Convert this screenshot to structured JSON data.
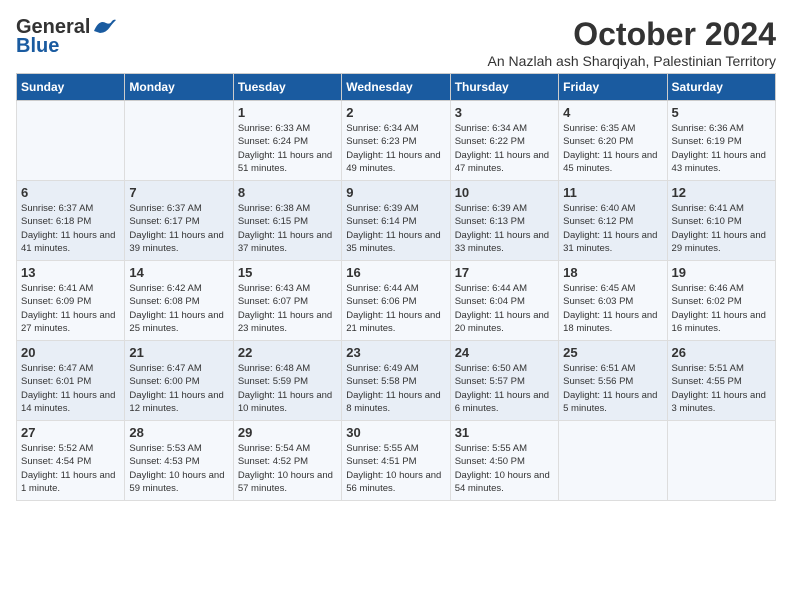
{
  "header": {
    "logo_general": "General",
    "logo_blue": "Blue",
    "month": "October 2024",
    "location": "An Nazlah ash Sharqiyah, Palestinian Territory"
  },
  "days_of_week": [
    "Sunday",
    "Monday",
    "Tuesday",
    "Wednesday",
    "Thursday",
    "Friday",
    "Saturday"
  ],
  "weeks": [
    [
      {
        "day": "",
        "detail": ""
      },
      {
        "day": "",
        "detail": ""
      },
      {
        "day": "1",
        "detail": "Sunrise: 6:33 AM\nSunset: 6:24 PM\nDaylight: 11 hours and 51 minutes."
      },
      {
        "day": "2",
        "detail": "Sunrise: 6:34 AM\nSunset: 6:23 PM\nDaylight: 11 hours and 49 minutes."
      },
      {
        "day": "3",
        "detail": "Sunrise: 6:34 AM\nSunset: 6:22 PM\nDaylight: 11 hours and 47 minutes."
      },
      {
        "day": "4",
        "detail": "Sunrise: 6:35 AM\nSunset: 6:20 PM\nDaylight: 11 hours and 45 minutes."
      },
      {
        "day": "5",
        "detail": "Sunrise: 6:36 AM\nSunset: 6:19 PM\nDaylight: 11 hours and 43 minutes."
      }
    ],
    [
      {
        "day": "6",
        "detail": "Sunrise: 6:37 AM\nSunset: 6:18 PM\nDaylight: 11 hours and 41 minutes."
      },
      {
        "day": "7",
        "detail": "Sunrise: 6:37 AM\nSunset: 6:17 PM\nDaylight: 11 hours and 39 minutes."
      },
      {
        "day": "8",
        "detail": "Sunrise: 6:38 AM\nSunset: 6:15 PM\nDaylight: 11 hours and 37 minutes."
      },
      {
        "day": "9",
        "detail": "Sunrise: 6:39 AM\nSunset: 6:14 PM\nDaylight: 11 hours and 35 minutes."
      },
      {
        "day": "10",
        "detail": "Sunrise: 6:39 AM\nSunset: 6:13 PM\nDaylight: 11 hours and 33 minutes."
      },
      {
        "day": "11",
        "detail": "Sunrise: 6:40 AM\nSunset: 6:12 PM\nDaylight: 11 hours and 31 minutes."
      },
      {
        "day": "12",
        "detail": "Sunrise: 6:41 AM\nSunset: 6:10 PM\nDaylight: 11 hours and 29 minutes."
      }
    ],
    [
      {
        "day": "13",
        "detail": "Sunrise: 6:41 AM\nSunset: 6:09 PM\nDaylight: 11 hours and 27 minutes."
      },
      {
        "day": "14",
        "detail": "Sunrise: 6:42 AM\nSunset: 6:08 PM\nDaylight: 11 hours and 25 minutes."
      },
      {
        "day": "15",
        "detail": "Sunrise: 6:43 AM\nSunset: 6:07 PM\nDaylight: 11 hours and 23 minutes."
      },
      {
        "day": "16",
        "detail": "Sunrise: 6:44 AM\nSunset: 6:06 PM\nDaylight: 11 hours and 21 minutes."
      },
      {
        "day": "17",
        "detail": "Sunrise: 6:44 AM\nSunset: 6:04 PM\nDaylight: 11 hours and 20 minutes."
      },
      {
        "day": "18",
        "detail": "Sunrise: 6:45 AM\nSunset: 6:03 PM\nDaylight: 11 hours and 18 minutes."
      },
      {
        "day": "19",
        "detail": "Sunrise: 6:46 AM\nSunset: 6:02 PM\nDaylight: 11 hours and 16 minutes."
      }
    ],
    [
      {
        "day": "20",
        "detail": "Sunrise: 6:47 AM\nSunset: 6:01 PM\nDaylight: 11 hours and 14 minutes."
      },
      {
        "day": "21",
        "detail": "Sunrise: 6:47 AM\nSunset: 6:00 PM\nDaylight: 11 hours and 12 minutes."
      },
      {
        "day": "22",
        "detail": "Sunrise: 6:48 AM\nSunset: 5:59 PM\nDaylight: 11 hours and 10 minutes."
      },
      {
        "day": "23",
        "detail": "Sunrise: 6:49 AM\nSunset: 5:58 PM\nDaylight: 11 hours and 8 minutes."
      },
      {
        "day": "24",
        "detail": "Sunrise: 6:50 AM\nSunset: 5:57 PM\nDaylight: 11 hours and 6 minutes."
      },
      {
        "day": "25",
        "detail": "Sunrise: 6:51 AM\nSunset: 5:56 PM\nDaylight: 11 hours and 5 minutes."
      },
      {
        "day": "26",
        "detail": "Sunrise: 5:51 AM\nSunset: 4:55 PM\nDaylight: 11 hours and 3 minutes."
      }
    ],
    [
      {
        "day": "27",
        "detail": "Sunrise: 5:52 AM\nSunset: 4:54 PM\nDaylight: 11 hours and 1 minute."
      },
      {
        "day": "28",
        "detail": "Sunrise: 5:53 AM\nSunset: 4:53 PM\nDaylight: 10 hours and 59 minutes."
      },
      {
        "day": "29",
        "detail": "Sunrise: 5:54 AM\nSunset: 4:52 PM\nDaylight: 10 hours and 57 minutes."
      },
      {
        "day": "30",
        "detail": "Sunrise: 5:55 AM\nSunset: 4:51 PM\nDaylight: 10 hours and 56 minutes."
      },
      {
        "day": "31",
        "detail": "Sunrise: 5:55 AM\nSunset: 4:50 PM\nDaylight: 10 hours and 54 minutes."
      },
      {
        "day": "",
        "detail": ""
      },
      {
        "day": "",
        "detail": ""
      }
    ]
  ]
}
